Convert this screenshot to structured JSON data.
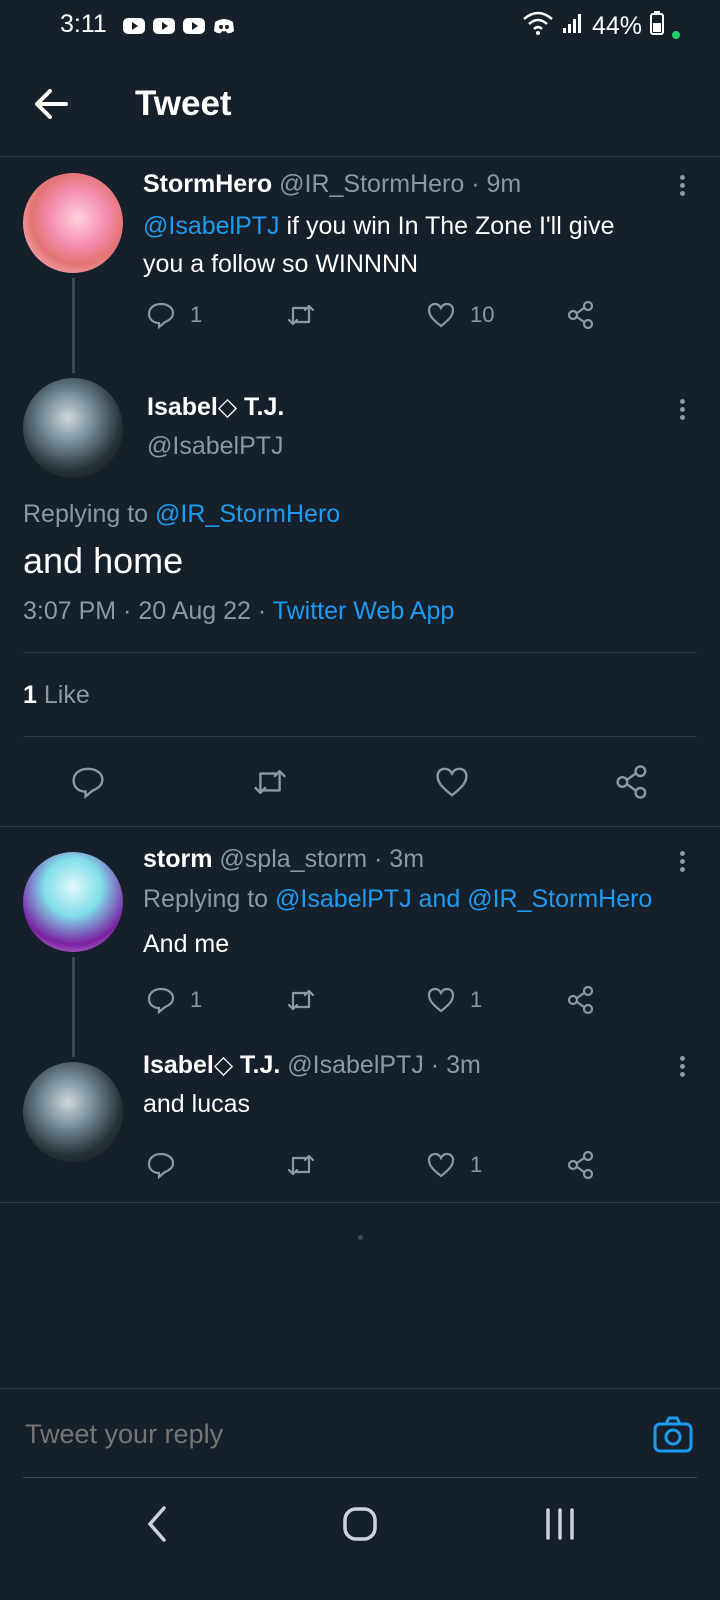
{
  "status_bar": {
    "time": "3:11",
    "battery": "44%"
  },
  "header": {
    "title": "Tweet"
  },
  "tweets": [
    {
      "name": "StormHero",
      "handle": "@IR_StormHero",
      "time": "· 9m",
      "mention": "@IsabelPTJ",
      "text_line1": " if you win In The Zone I'll give",
      "text_line2": "you a follow so WINNNN",
      "reply_count": "1",
      "like_count": "10"
    },
    {
      "name": "Isabel◇ T.J.",
      "handle": "@IsabelPTJ",
      "replying_prefix": "Replying to ",
      "replying_to": "@IR_StormHero",
      "text": "and home",
      "timestamp": "3:07 PM · 20 Aug 22 · ",
      "source": "Twitter Web App",
      "likes_number": "1",
      "likes_label": "Like"
    },
    {
      "name": "storm",
      "handle": "@spla_storm",
      "time": "· 3m",
      "replying_prefix": "Replying to ",
      "replying_to_1": "@IsabelPTJ",
      "replying_and": " and ",
      "replying_to_2": "@IR_StormHero",
      "text": "And me",
      "reply_count": "1",
      "like_count": "1"
    },
    {
      "name": "Isabel◇ T.J.",
      "handle": "@IsabelPTJ",
      "time": "· 3m",
      "text": "and lucas",
      "like_count": "1"
    }
  ],
  "reply_bar": {
    "placeholder": "Tweet your reply"
  },
  "colors": {
    "background": "#15202b",
    "accent": "#1d9bf0",
    "muted": "#8b98a5",
    "divider": "#2f3a45"
  },
  "icons": {
    "status": [
      "youtube-icon",
      "youtube-icon",
      "youtube-icon",
      "discord-icon",
      "wifi-icon",
      "signal-icon",
      "battery-icon"
    ],
    "actions": [
      "reply-icon",
      "retweet-icon",
      "like-icon",
      "share-icon"
    ],
    "reply_bar": [
      "camera-icon"
    ],
    "nav": [
      "back-nav-icon",
      "home-nav-icon",
      "recents-nav-icon"
    ]
  }
}
